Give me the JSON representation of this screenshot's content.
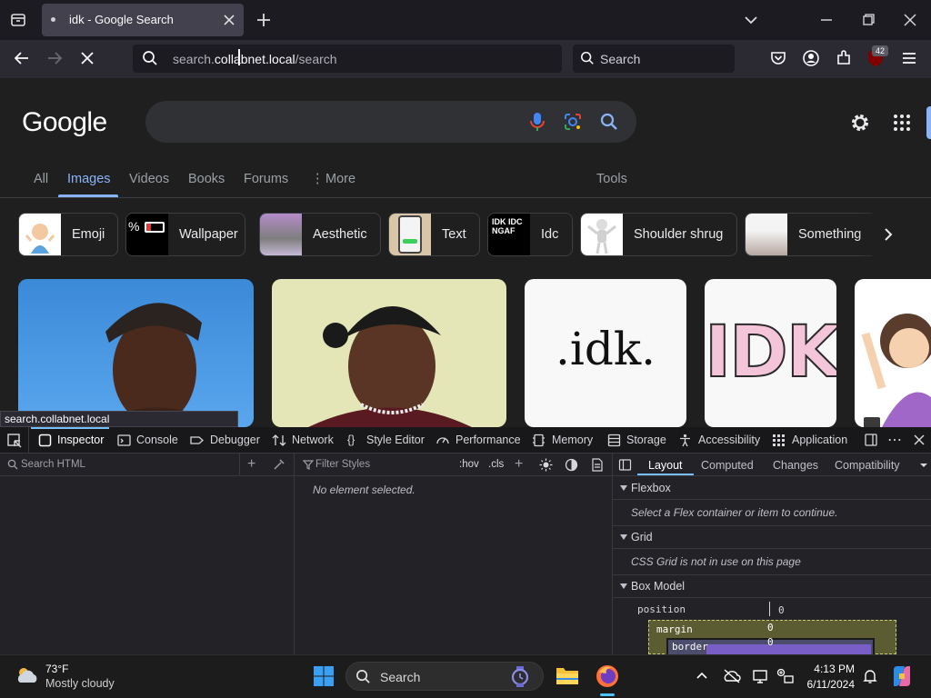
{
  "browser": {
    "tab_title": "idk - Google Search",
    "url_host_prefix": "search.",
    "url_host_main": "collabnet.local",
    "url_path": "/search",
    "search_placeholder": "Search",
    "extension_badge": "42",
    "status_url": "search.collabnet.local"
  },
  "google": {
    "logo": "Google",
    "tabs": [
      {
        "label": "All"
      },
      {
        "label": "Images"
      },
      {
        "label": "Videos"
      },
      {
        "label": "Books"
      },
      {
        "label": "Forums"
      },
      {
        "label": "More"
      },
      {
        "label": "Tools"
      }
    ],
    "chips": [
      {
        "label": "Emoji"
      },
      {
        "label": "Wallpaper"
      },
      {
        "label": "Aesthetic"
      },
      {
        "label": "Text"
      },
      {
        "label": "Idc"
      },
      {
        "label": "Shoulder shrug"
      },
      {
        "label": "Something"
      }
    ],
    "chip_thumb_texts": {
      "wallpaper": "%",
      "idc_thumb": "IDK IDC NGAF"
    },
    "images": [
      {
        "alt": "man with beanie"
      },
      {
        "alt": "man with durag"
      },
      {
        "alt": "idk text"
      },
      {
        "alt": "IDK letters"
      },
      {
        "alt": "shrug emoji"
      }
    ],
    "image_texts": {
      "idk_text": ".idk.",
      "idk_letters": "IDK"
    }
  },
  "devtools": {
    "tabs": [
      {
        "label": "Inspector"
      },
      {
        "label": "Console"
      },
      {
        "label": "Debugger"
      },
      {
        "label": "Network"
      },
      {
        "label": "Style Editor"
      },
      {
        "label": "Performance"
      },
      {
        "label": "Memory"
      },
      {
        "label": "Storage"
      },
      {
        "label": "Accessibility"
      },
      {
        "label": "Application"
      }
    ],
    "search_html_placeholder": "Search HTML",
    "filter_styles_placeholder": "Filter Styles",
    "hov": ":hov",
    "cls": ".cls",
    "no_element": "No element selected.",
    "layout_tabs": [
      {
        "label": "Layout"
      },
      {
        "label": "Computed"
      },
      {
        "label": "Changes"
      },
      {
        "label": "Compatibility"
      }
    ],
    "flexbox_head": "Flexbox",
    "flexbox_note": "Select a Flex container or item to continue.",
    "grid_head": "Grid",
    "grid_note": "CSS Grid is not in use on this page",
    "boxmodel_head": "Box Model",
    "position_label": "position",
    "position_value": "0",
    "margin_label": "margin",
    "margin_value": "0",
    "border_label": "border",
    "border_value": "0"
  },
  "taskbar": {
    "weather_temp": "73°F",
    "weather_desc": "Mostly cloudy",
    "search_label": "Search",
    "time": "4:13 PM",
    "date": "6/11/2024"
  },
  "colors": {
    "accent_blue": "#8ab4f8",
    "devtools_accent": "#75bfff",
    "boxmodel_margin": "#5c5c32",
    "boxmodel_border": "#4c4c6c"
  }
}
